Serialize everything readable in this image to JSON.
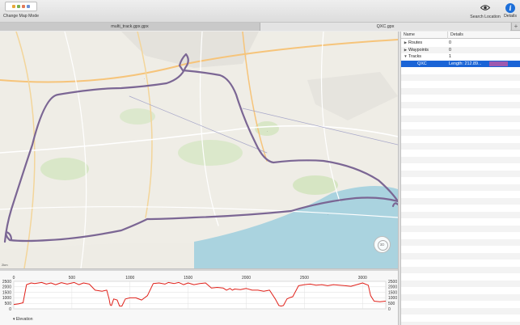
{
  "toolbar": {
    "change_map_mode_label": "Change Map Mode",
    "search_location_label": "Search Location",
    "details_label": "Details",
    "details_icon_glyph": "i"
  },
  "tabs": [
    {
      "label": "multi_track.gpx.gpx"
    },
    {
      "label": "QXC.gpx"
    }
  ],
  "tab_add_glyph": "+",
  "map": {
    "scale_label": "2km",
    "compass_label": "3D",
    "zoom_out_glyph": "−",
    "zoom_in_glyph": "+",
    "track_color": "#7b6694"
  },
  "elevation": {
    "label": "Elevation",
    "line_color": "#e0211a",
    "x_ticks": [
      "0",
      "500",
      "1000",
      "1500",
      "2000",
      "2500",
      "3000"
    ],
    "y_ticks": [
      "2500",
      "2000",
      "1500",
      "1000",
      "500",
      "0"
    ],
    "x_range": [
      0,
      3200
    ],
    "y_range": [
      0,
      2500
    ],
    "x": [
      0,
      40,
      80,
      110,
      150,
      180,
      240,
      280,
      320,
      360,
      410,
      460,
      520,
      560,
      600,
      650,
      700,
      760,
      800,
      820,
      830,
      840,
      860,
      890,
      910,
      930,
      960,
      1000,
      1050,
      1100,
      1150,
      1200,
      1250,
      1300,
      1330,
      1380,
      1420,
      1460,
      1500,
      1550,
      1600,
      1650,
      1700,
      1750,
      1800,
      1830,
      1860,
      1880,
      1900,
      1950,
      2000,
      2050,
      2100,
      2150,
      2200,
      2250,
      2280,
      2300,
      2320,
      2350,
      2370,
      2400,
      2450,
      2500,
      2550,
      2600,
      2650,
      2700,
      2750,
      2800,
      2850,
      2900,
      2950,
      3000,
      3050,
      3070,
      3100,
      3150,
      3200
    ],
    "y": [
      400,
      450,
      550,
      2200,
      2350,
      2300,
      2400,
      2250,
      2350,
      2200,
      2380,
      2250,
      2400,
      2200,
      2350,
      2250,
      1700,
      1600,
      1700,
      900,
      350,
      300,
      900,
      800,
      250,
      250,
      900,
      1000,
      1000,
      800,
      1200,
      2300,
      2350,
      2250,
      2400,
      2300,
      2400,
      2200,
      2350,
      2200,
      2300,
      2350,
      1900,
      1950,
      1900,
      1700,
      1850,
      1700,
      1800,
      1750,
      1850,
      1700,
      1700,
      1600,
      1700,
      900,
      300,
      250,
      300,
      900,
      1000,
      1100,
      2100,
      2200,
      2250,
      2150,
      2200,
      2100,
      2200,
      2150,
      2100,
      2050,
      2200,
      2350,
      2150,
      1200,
      700,
      650,
      700
    ]
  },
  "outline": {
    "col_name": "Name",
    "col_details": "Details",
    "rows": [
      {
        "name": "Routes",
        "value": "0",
        "tri": "▶"
      },
      {
        "name": "Waypoints",
        "value": "0",
        "tri": "▶"
      },
      {
        "name": "Tracks",
        "value": "1",
        "tri": "▼"
      },
      {
        "name": "QXC",
        "value": "Length: 212.89...",
        "tri": ""
      }
    ],
    "selected_swatch_color": "#9d59b0",
    "selection_color": "#1a64d6"
  }
}
